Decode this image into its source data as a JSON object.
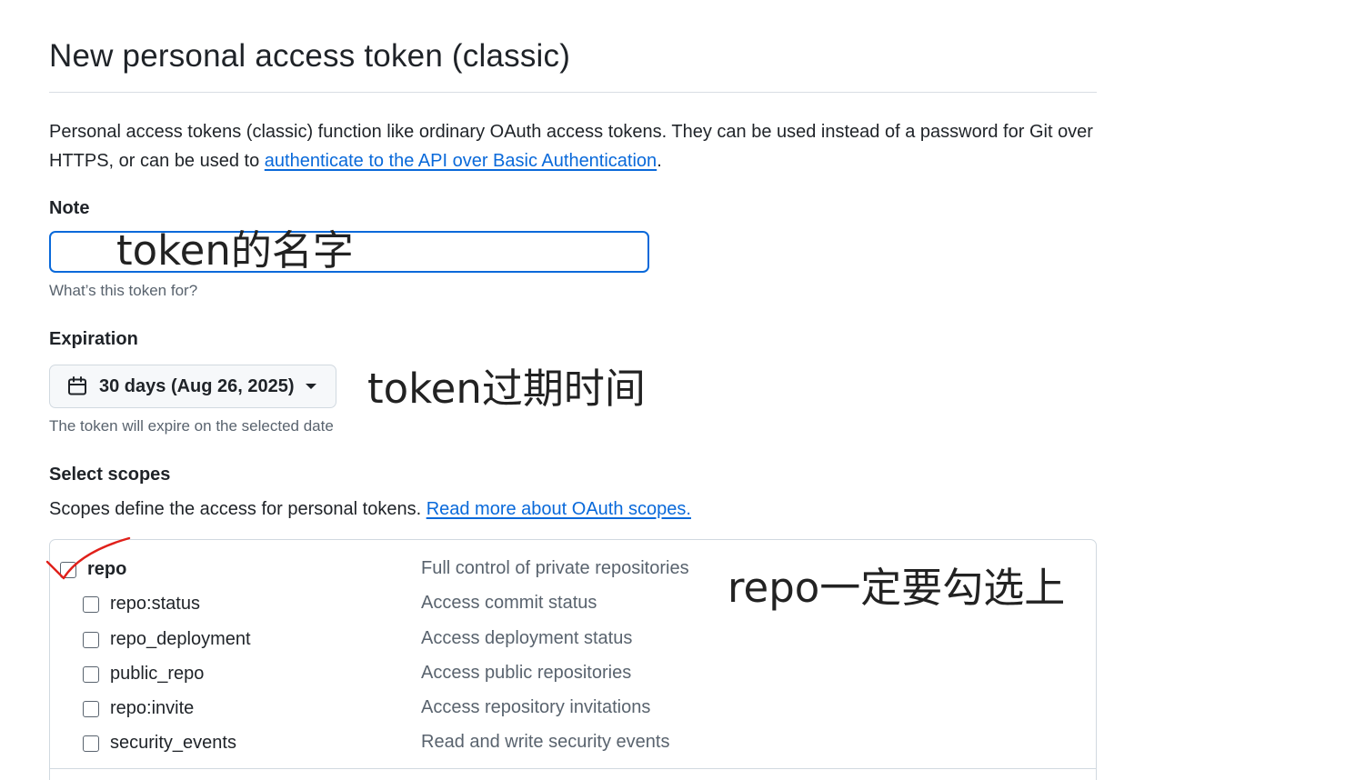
{
  "page": {
    "title": "New personal access token (classic)",
    "intro_text": "Personal access tokens (classic) function like ordinary OAuth access tokens. They can be used instead of a password for Git over HTTPS, or can be used to ",
    "intro_link": "authenticate to the API over Basic Authentication",
    "intro_end": "."
  },
  "note": {
    "label": "Note",
    "value": "",
    "hint": "What’s this token for?"
  },
  "expiration": {
    "label": "Expiration",
    "selected": "30 days (Aug 26, 2025)",
    "hint": "The token will expire on the selected date"
  },
  "scopes": {
    "label": "Select scopes",
    "description": "Scopes define the access for personal tokens. ",
    "link": "Read more about OAuth scopes.",
    "items": [
      {
        "name": "repo",
        "description": "Full control of private repositories",
        "checked": true
      },
      {
        "name": "repo:status",
        "description": "Access commit status",
        "checked": false
      },
      {
        "name": "repo_deployment",
        "description": "Access deployment status",
        "checked": false
      },
      {
        "name": "public_repo",
        "description": "Access public repositories",
        "checked": false
      },
      {
        "name": "repo:invite",
        "description": "Access repository invitations",
        "checked": false
      },
      {
        "name": "security_events",
        "description": "Read and write security events",
        "checked": false
      }
    ]
  },
  "annotations": {
    "note": "token的名字",
    "expiration": "token过期时间",
    "repo": "repo一定要勾选上"
  },
  "colors": {
    "link": "#0969da",
    "annotation_check": "#e0201a"
  }
}
